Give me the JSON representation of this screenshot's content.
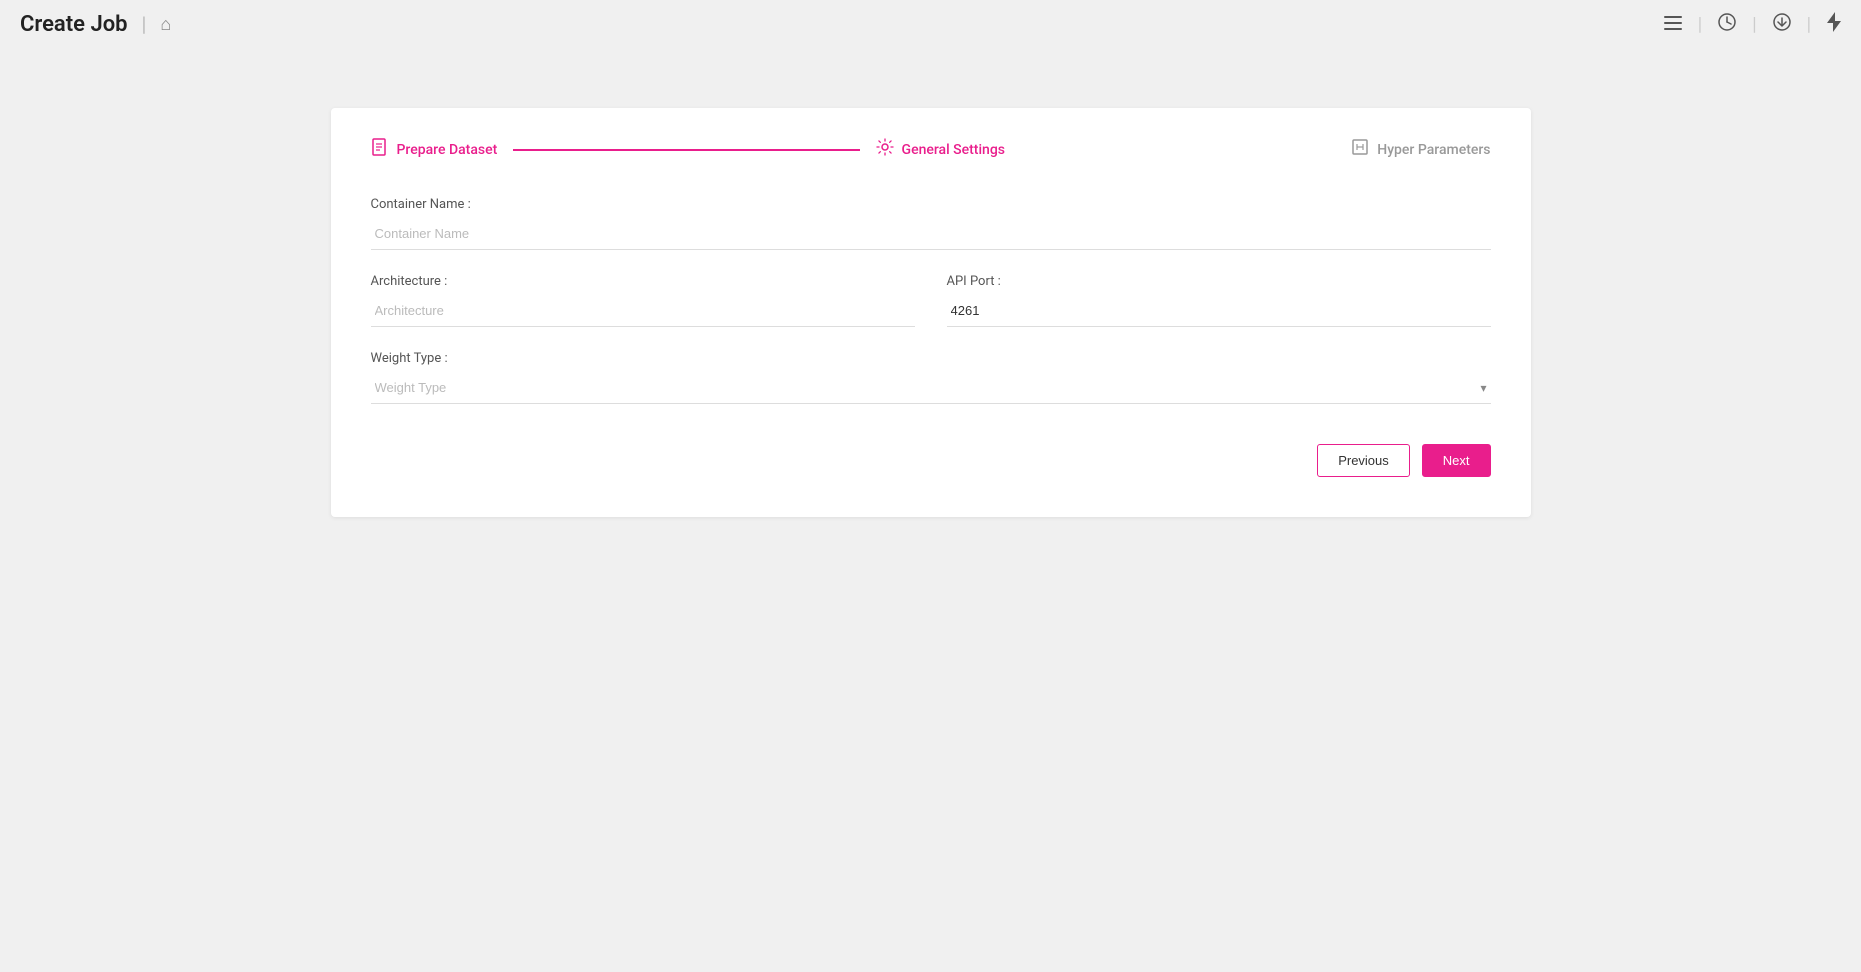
{
  "header": {
    "title": "Create Job",
    "divider": "|",
    "icons": {
      "home": "🏠",
      "list": "☰",
      "clock": "🕐",
      "download": "⬇",
      "lightning": "⚡"
    }
  },
  "stepper": {
    "steps": [
      {
        "id": "prepare-dataset",
        "icon": "📋",
        "label": "Prepare Dataset",
        "active": true
      },
      {
        "id": "general-settings",
        "icon": "⚙",
        "label": "General Settings",
        "active": true
      },
      {
        "id": "hyper-parameters",
        "icon": "✏",
        "label": "Hyper Parameters",
        "active": false
      }
    ]
  },
  "form": {
    "container_name_label": "Container Name :",
    "container_name_placeholder": "Container Name",
    "architecture_label": "Architecture :",
    "architecture_placeholder": "Architecture",
    "api_port_label": "API Port :",
    "api_port_value": "4261",
    "weight_type_label": "Weight Type :",
    "weight_type_placeholder": "Weight Type"
  },
  "buttons": {
    "previous": "Previous",
    "next": "Next"
  }
}
